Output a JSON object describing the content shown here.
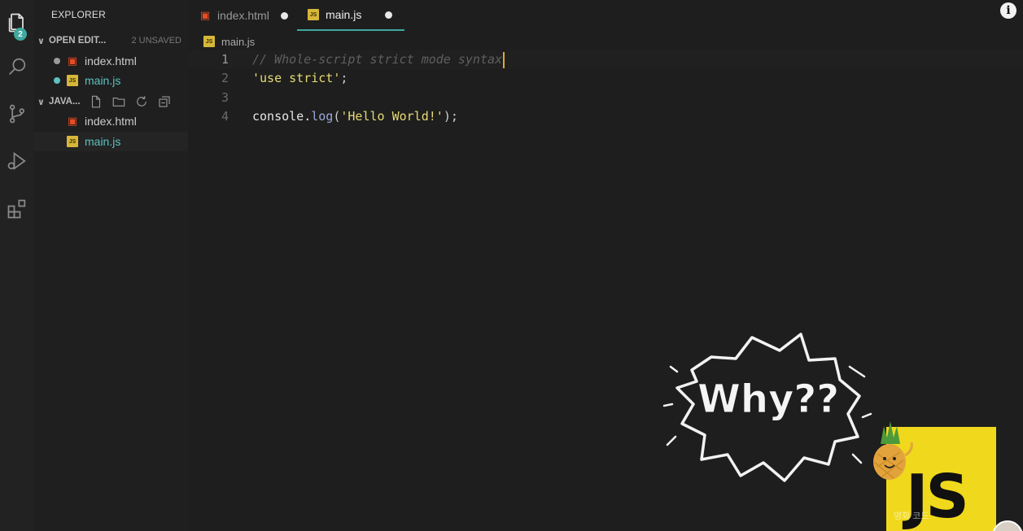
{
  "activity_bar": {
    "explorer_badge": "2"
  },
  "sidebar": {
    "title": "EXPLORER",
    "open_editors": {
      "label": "OPEN EDIT...",
      "meta": "2 UNSAVED",
      "files": [
        {
          "name": "index.html",
          "type": "html"
        },
        {
          "name": "main.js",
          "type": "js"
        }
      ]
    },
    "folder": {
      "label": "JAVA...",
      "files": [
        {
          "name": "index.html",
          "type": "html"
        },
        {
          "name": "main.js",
          "type": "js"
        }
      ]
    }
  },
  "tabs": [
    {
      "label": "index.html",
      "type": "html",
      "modified": true
    },
    {
      "label": "main.js",
      "type": "js",
      "modified": true,
      "active": true
    }
  ],
  "breadcrumb": "main.js",
  "editor": {
    "lines": [
      {
        "n": "1",
        "comment": "// Whole-script strict mode syntax"
      },
      {
        "n": "2",
        "str": "'use strict'",
        "punc": ";"
      },
      {
        "n": "3"
      },
      {
        "n": "4",
        "obj": "console",
        "dot": ".",
        "fn": "log",
        "open": "(",
        "str": "'Hello World!'",
        "close": ");"
      }
    ]
  },
  "overlay": {
    "bubble_text": "Why??",
    "logo_text": "JS",
    "watermark": "영화 코드"
  },
  "colors": {
    "accent": "#3fa8a0",
    "caret": "#e0a82e",
    "string": "#e6db74",
    "function": "#9aa8d8",
    "comment": "#5f5f5f",
    "js_yellow": "#f0d91c"
  }
}
